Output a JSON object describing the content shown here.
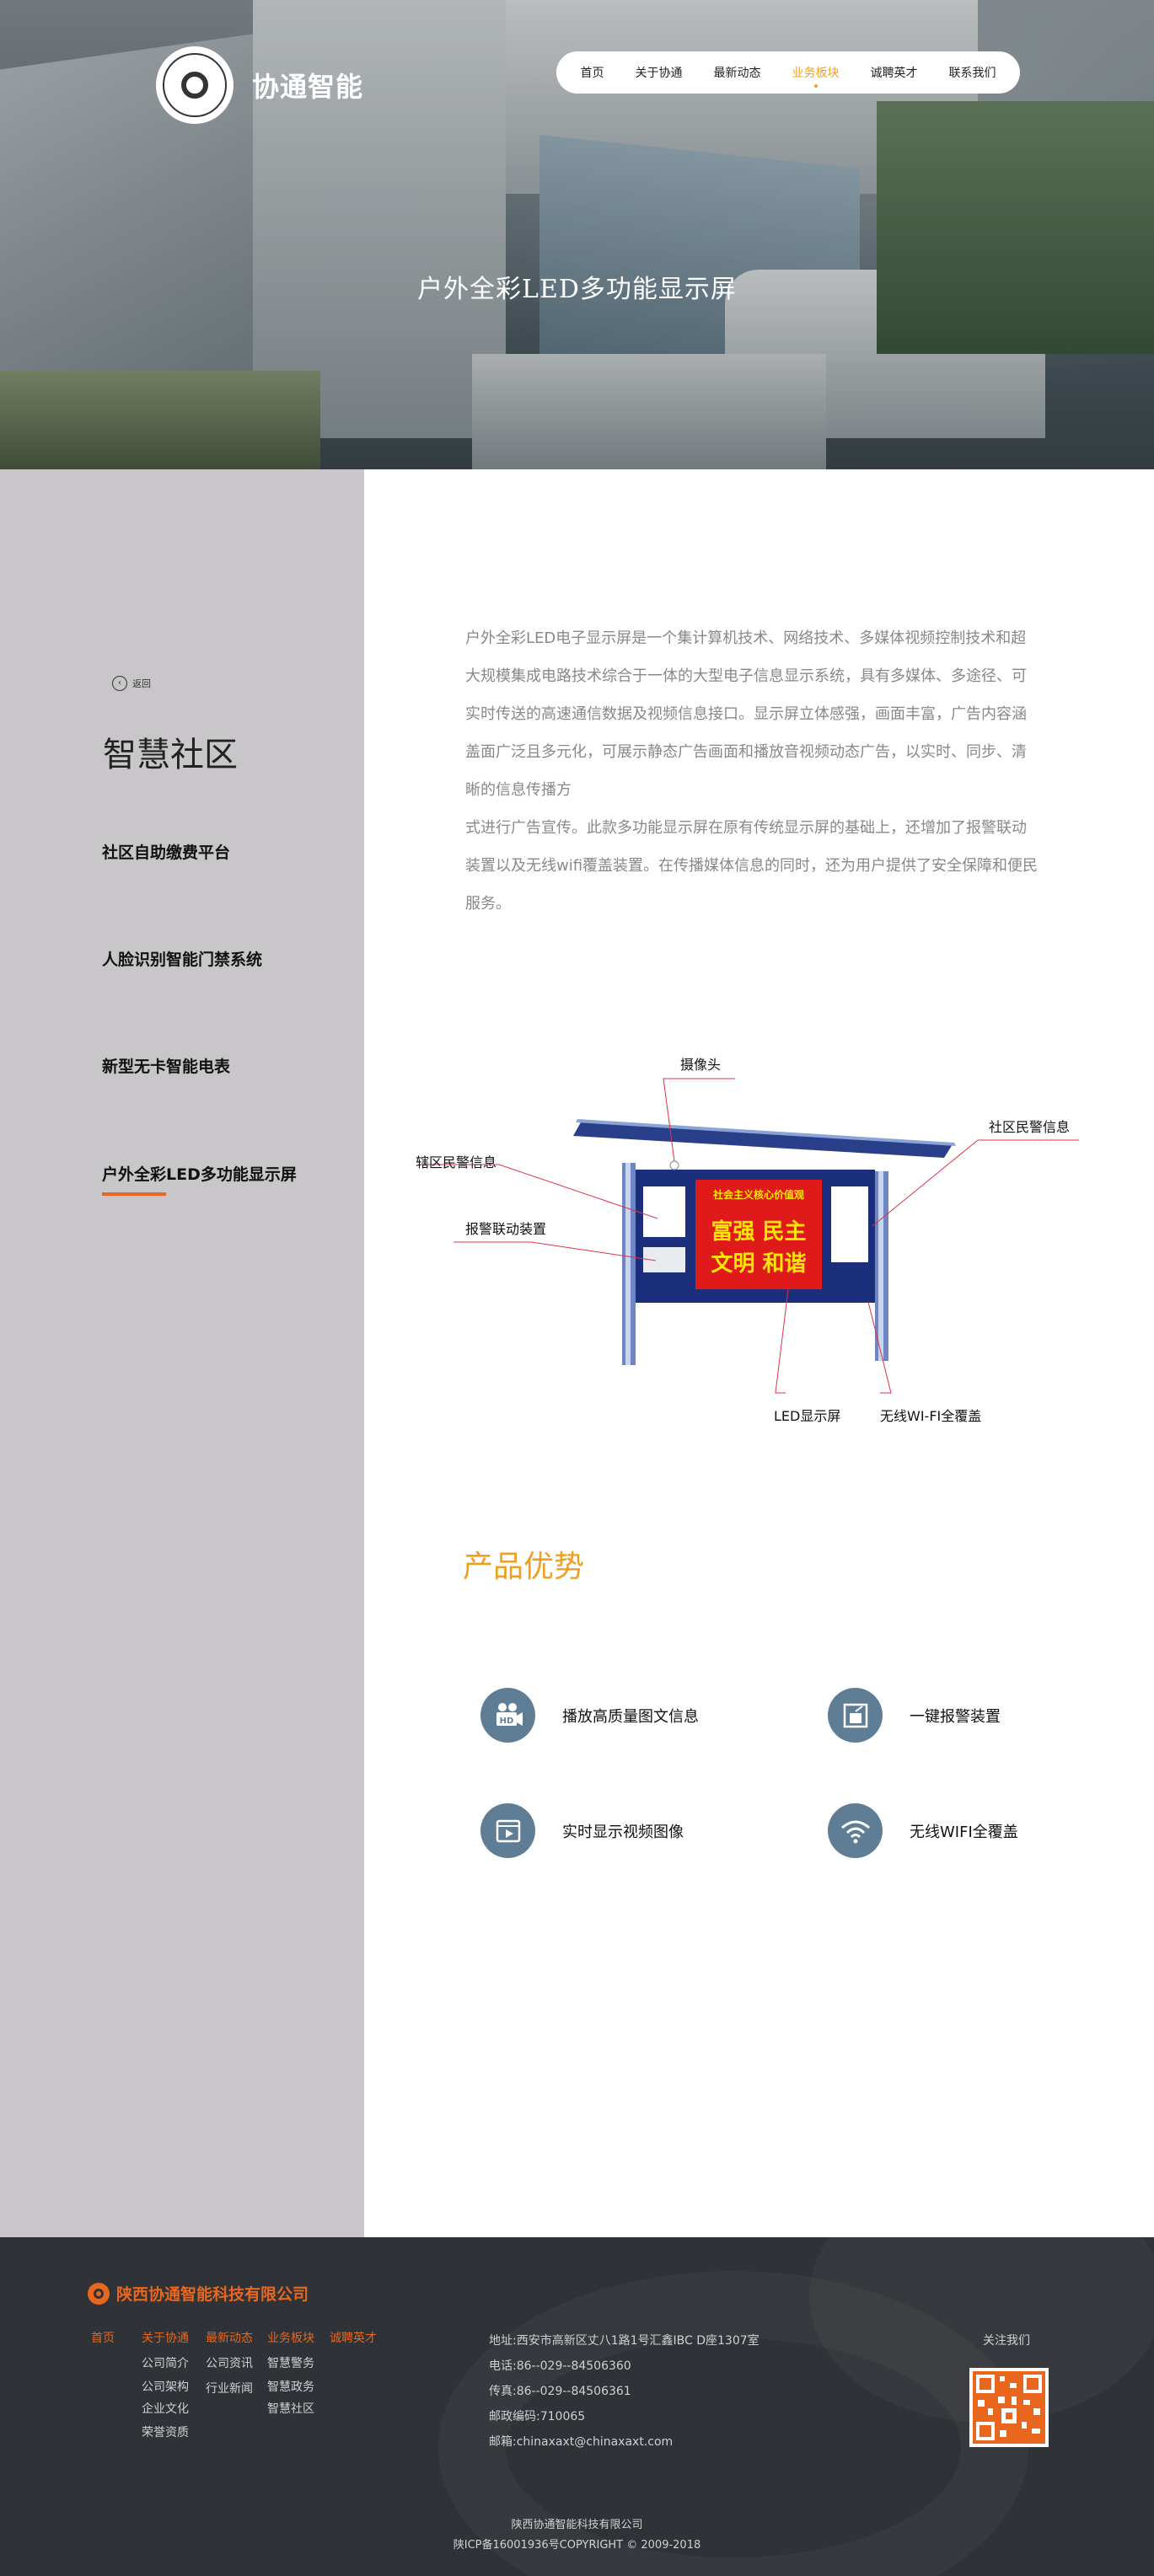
{
  "brand": {
    "logo_text": "协通智能"
  },
  "nav": {
    "items": [
      "首页",
      "关于协通",
      "最新动态",
      "业务板块",
      "诚聘英才",
      "联系我们"
    ],
    "active": "业务板块"
  },
  "hero": {
    "title": "户外全彩LED多功能显示屏"
  },
  "sidebar": {
    "back_label": "返回",
    "title": "智慧社区",
    "items": [
      "社区自助缴费平台",
      "人脸识别智能门禁系统",
      "新型无卡智能电表",
      "户外全彩LED多功能显示屏"
    ],
    "active": "户外全彩LED多功能显示屏"
  },
  "intro": {
    "paragraphs": [
      "户外全彩LED电子显示屏是一个集计算机技术、网络技术、多媒体视频控制技术和超大规模集成电路技术综合于一体的大型电子信息显示系统，具有多媒体、多途径、可实时传送的高速通信数据及视频信息接口。显示屏立体感强，画面丰富，广告内容涵盖面广泛且多元化，可展示静态广告画面和播放音视频动态广告，以实时、同步、清晰的信息传播方",
      "式进行广告宣传。此款多功能显示屏在原有传统显示屏的基础上，还增加了报警联动装置以及无线wifi覆盖装置。在传播媒体信息的同时，还为用户提供了安全保障和便民服务。"
    ]
  },
  "diagram": {
    "labels": {
      "camera": "摄像头",
      "community_police": "社区民警信息",
      "district_police": "辖区民警信息",
      "alarm": "报警联动装置",
      "led": "LED显示屏",
      "wifi": "无线WI-FI全覆盖"
    },
    "screen_header": "社会主义核心价值观",
    "screen_line1": "富强 民主",
    "screen_line2": "文明 和谐"
  },
  "advantages": {
    "title": "产品优势",
    "features": [
      {
        "label": "播放高质量图文信息",
        "icon": "hd-camera-icon"
      },
      {
        "label": "一键报警装置",
        "icon": "alarm-panel-icon"
      },
      {
        "label": "实时显示视频图像",
        "icon": "video-play-icon"
      },
      {
        "label": "无线WIFI全覆盖",
        "icon": "wifi-icon"
      }
    ]
  },
  "footer": {
    "company": "陕西协通智能科技有限公司",
    "col_home": {
      "head": "首页",
      "links": []
    },
    "col_about": {
      "head": "关于协通",
      "links": [
        "公司简介",
        "公司架构",
        "企业文化",
        "荣誉资质"
      ]
    },
    "col_news": {
      "head": "最新动态",
      "links": [
        "公司资讯",
        "行业新闻"
      ]
    },
    "col_business": {
      "head": "业务板块",
      "links": [
        "智慧警务",
        "智慧政务",
        "智慧社区"
      ]
    },
    "col_jobs": {
      "head": "诚聘英才",
      "links": []
    },
    "contact": [
      "地址:西安市高新区丈八1路1号汇鑫IBC D座1307室",
      "电话:86--029--84506360",
      "传真:86--029--84506361",
      "邮政编码:710065",
      "邮箱:chinaxaxt@chinaxaxt.com"
    ],
    "follow_label": "关注我们",
    "copyright_company": "陕西协通智能科技有限公司",
    "copyright_line": "陕ICP备16001936号COPYRIGHT © 2009-2018"
  },
  "colors": {
    "accent": "#f0a020",
    "brand_orange": "#e8661e",
    "sidebar_bg": "#c8c6c9",
    "footer_bg": "#2f3236",
    "icon_bg": "#607d96"
  }
}
